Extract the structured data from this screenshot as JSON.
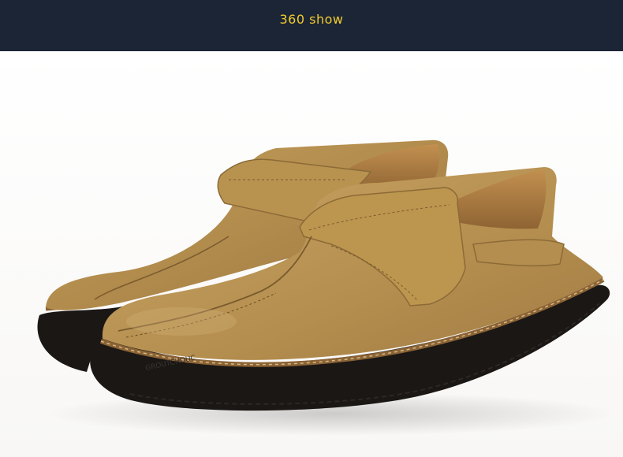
{
  "banner": {
    "title": "360 show",
    "background_color": "#1c2536",
    "text_color": "#f2cb2f"
  },
  "product_photo": {
    "subject": "pair of tan leather hook-and-loop strap loafers",
    "sole_imprint": "GROUTCHOUC",
    "leather_color": "#b48e4e",
    "sole_color": "#1a1715"
  }
}
